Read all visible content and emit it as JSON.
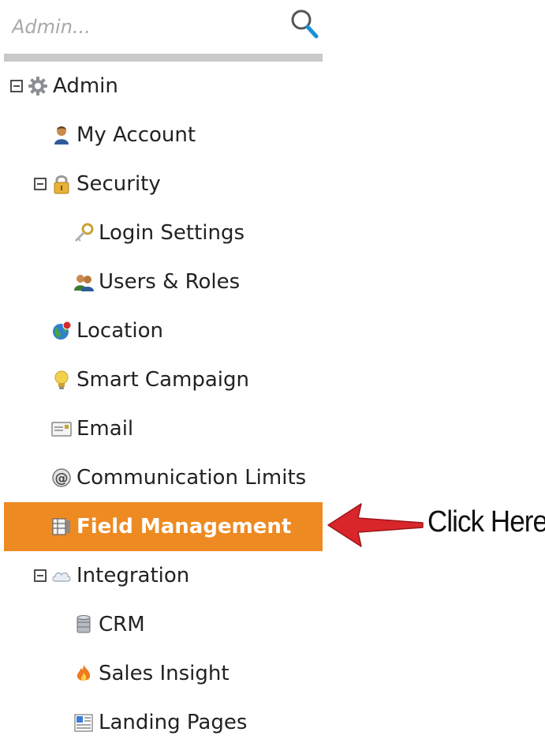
{
  "search": {
    "placeholder": "Admin...",
    "icon": "search-icon"
  },
  "tree": [
    {
      "key": "admin",
      "label": "Admin",
      "icon": "gear-icon",
      "expanded": true,
      "selected": false
    },
    {
      "key": "my-account",
      "label": "My Account",
      "icon": "user-icon",
      "selected": false
    },
    {
      "key": "security",
      "label": "Security",
      "icon": "lock-icon",
      "expanded": true,
      "selected": false
    },
    {
      "key": "login-settings",
      "label": "Login Settings",
      "icon": "key-icon",
      "selected": false
    },
    {
      "key": "users-roles",
      "label": "Users & Roles",
      "icon": "users-icon",
      "selected": false
    },
    {
      "key": "location",
      "label": "Location",
      "icon": "globe-icon",
      "selected": false
    },
    {
      "key": "smart-campaign",
      "label": "Smart Campaign",
      "icon": "lightbulb-icon",
      "selected": false
    },
    {
      "key": "email",
      "label": "Email",
      "icon": "email-icon",
      "selected": false
    },
    {
      "key": "communication-limits",
      "label": "Communication Limits",
      "icon": "at-sign-icon",
      "selected": false
    },
    {
      "key": "field-management",
      "label": "Field Management",
      "icon": "field-management-icon",
      "selected": true
    },
    {
      "key": "integration",
      "label": "Integration",
      "icon": "cloud-icon",
      "expanded": true,
      "selected": false
    },
    {
      "key": "crm",
      "label": "CRM",
      "icon": "database-icon",
      "selected": false
    },
    {
      "key": "sales-insight",
      "label": "Sales Insight",
      "icon": "flame-icon",
      "selected": false
    },
    {
      "key": "landing-pages",
      "label": "Landing Pages",
      "icon": "landing-pages-icon",
      "selected": false
    }
  ],
  "annotation": {
    "text": "Click Here",
    "arrow_color": "#d8262b"
  },
  "colors": {
    "selected_bg": "#ee8a22",
    "selected_text": "#ffffff",
    "search_bar": "#c9c9c9"
  }
}
